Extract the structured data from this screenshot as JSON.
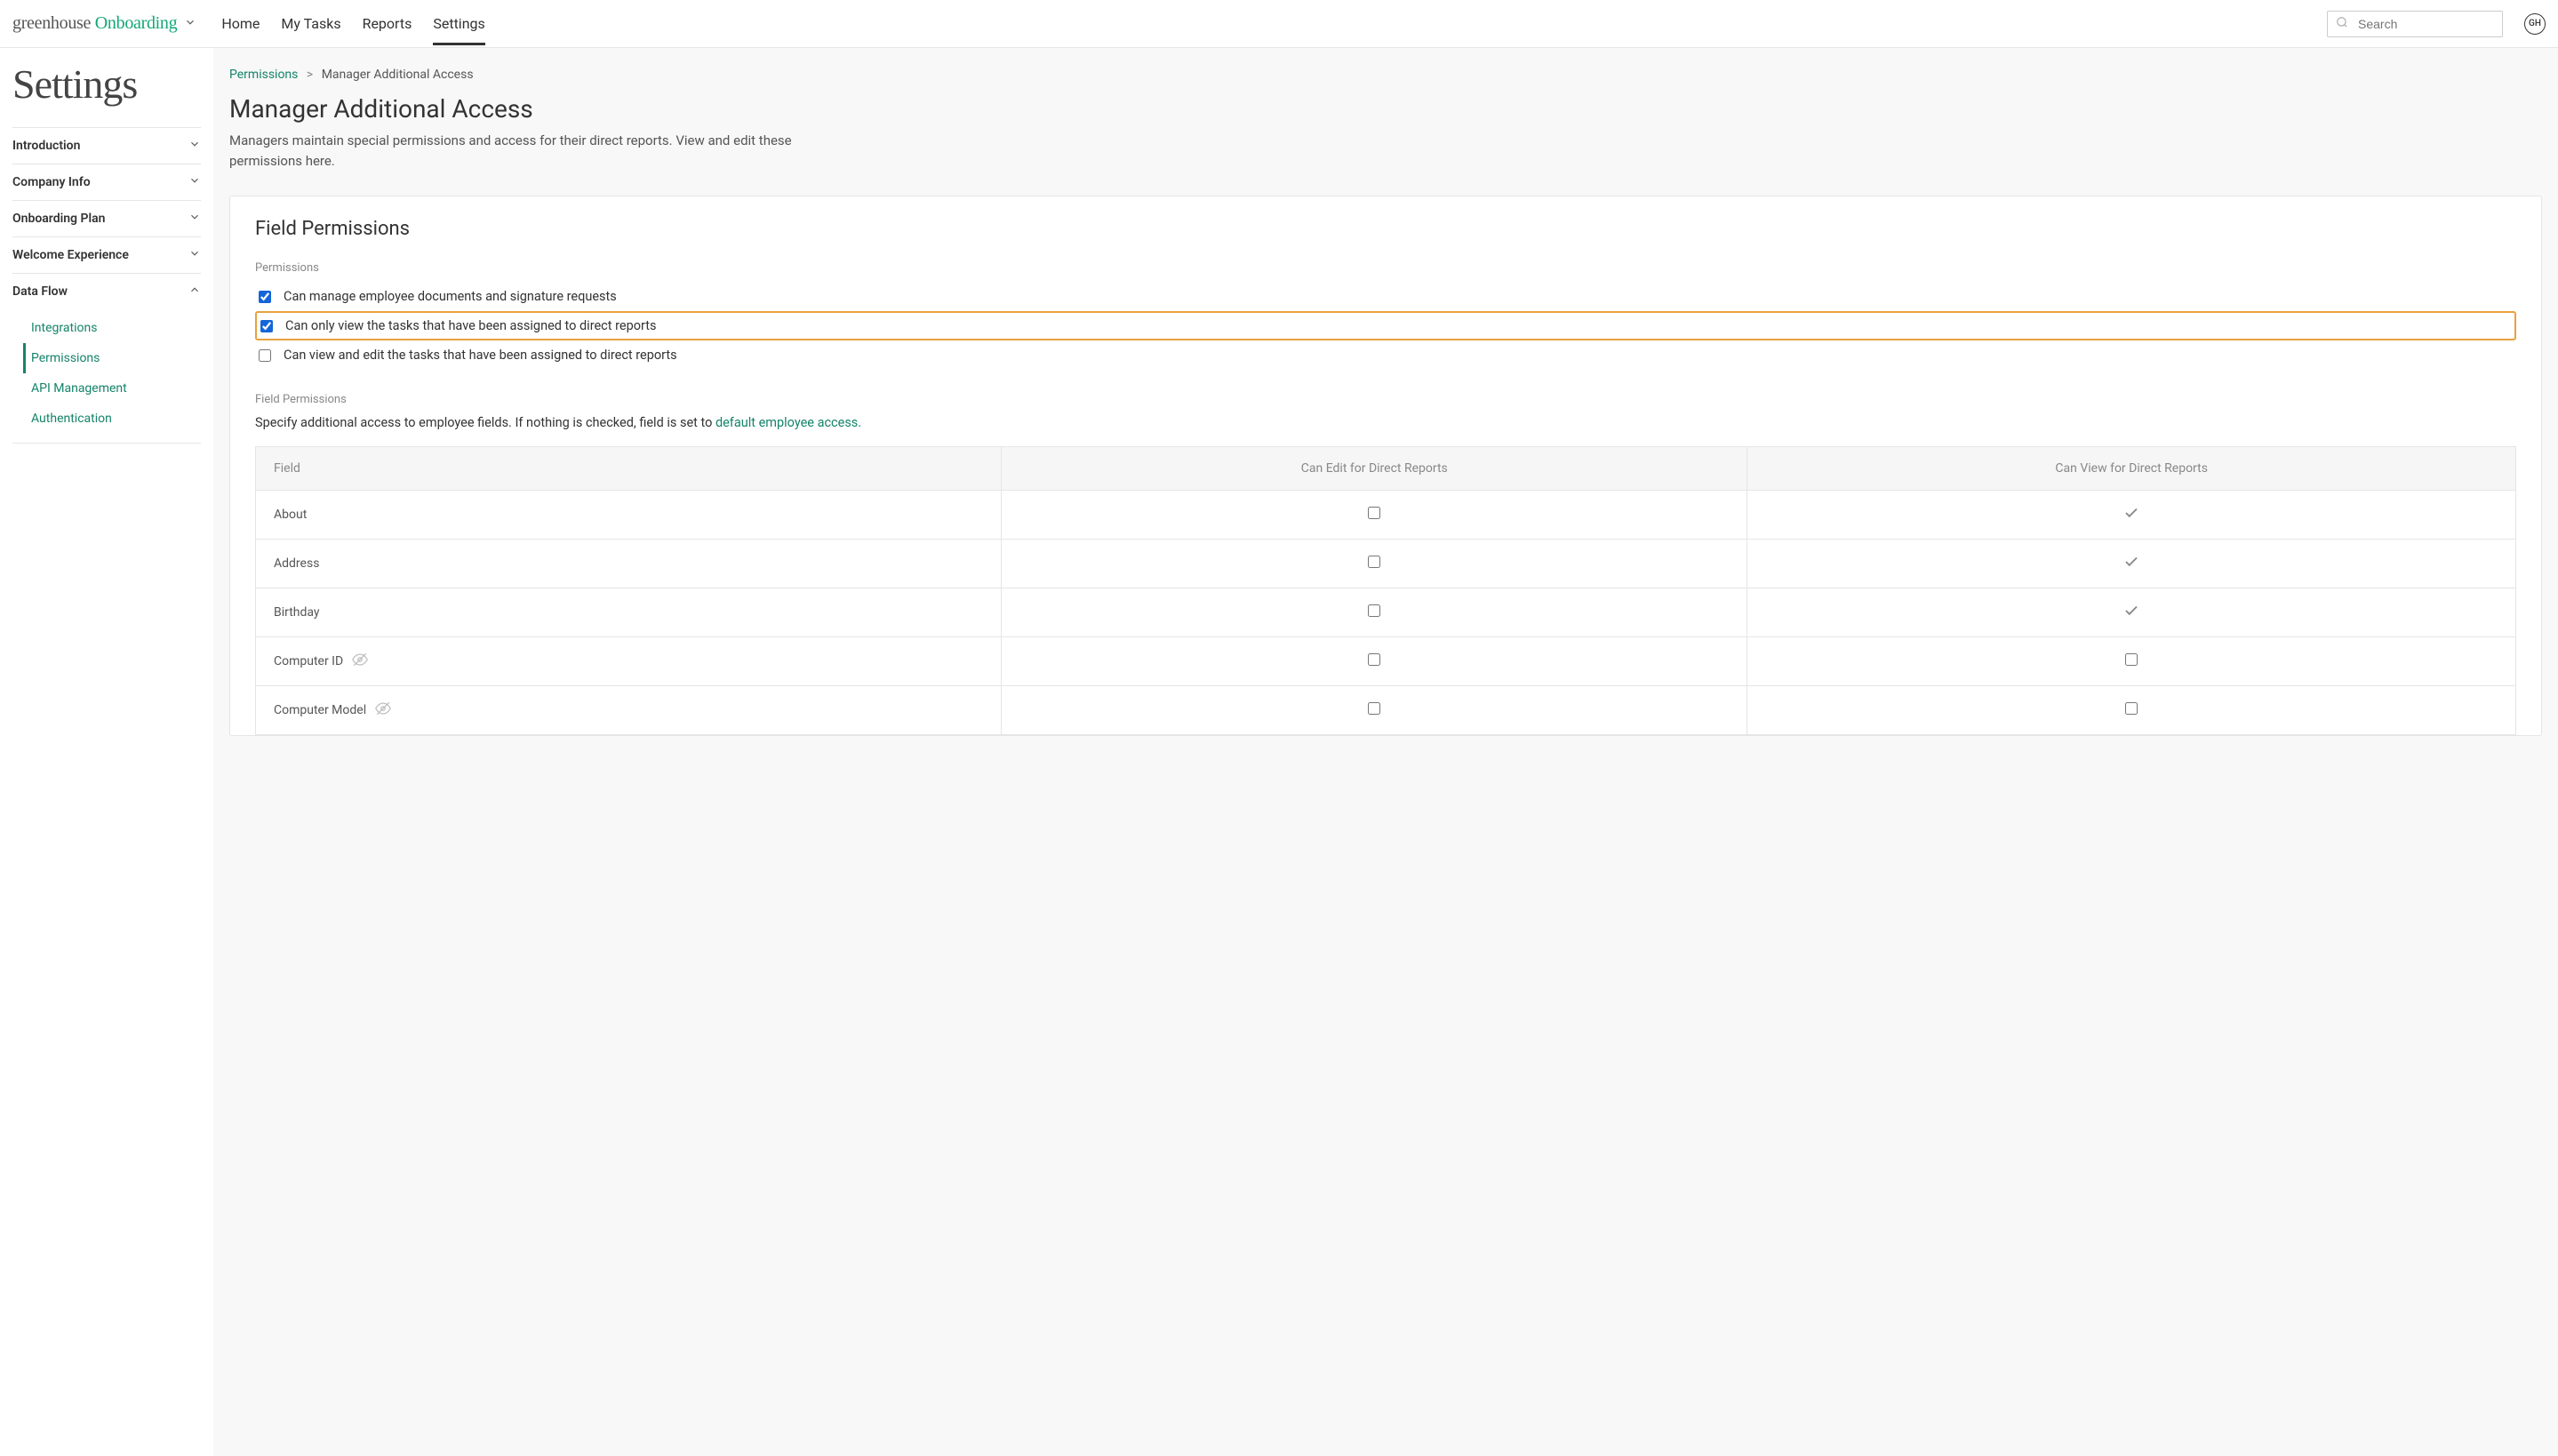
{
  "header": {
    "logo_primary": "greenhouse",
    "logo_secondary": "Onboarding",
    "nav": [
      {
        "label": "Home"
      },
      {
        "label": "My Tasks"
      },
      {
        "label": "Reports"
      },
      {
        "label": "Settings"
      }
    ],
    "search_placeholder": "Search",
    "avatar_initials": "GH"
  },
  "sidebar": {
    "title": "Settings",
    "sections": [
      {
        "label": "Introduction",
        "expanded": false
      },
      {
        "label": "Company Info",
        "expanded": false
      },
      {
        "label": "Onboarding Plan",
        "expanded": false
      },
      {
        "label": "Welcome Experience",
        "expanded": false
      },
      {
        "label": "Data Flow",
        "expanded": true,
        "items": [
          {
            "label": "Integrations"
          },
          {
            "label": "Permissions"
          },
          {
            "label": "API Management"
          },
          {
            "label": "Authentication"
          }
        ]
      }
    ]
  },
  "breadcrumb": {
    "parent": "Permissions",
    "sep": ">",
    "current": "Manager Additional Access"
  },
  "main": {
    "heading": "Manager Additional Access",
    "description": "Managers maintain special permissions and access for their direct reports. View and edit these permissions here."
  },
  "card": {
    "title": "Field Permissions",
    "perm_section_label": "Permissions",
    "perms": [
      {
        "label": "Can manage employee documents and signature requests",
        "checked": true,
        "highlight": false
      },
      {
        "label": "Can only view the tasks that have been assigned to direct reports",
        "checked": true,
        "highlight": true
      },
      {
        "label": "Can view and edit the tasks that have been assigned to direct reports",
        "checked": false,
        "highlight": false
      }
    ],
    "field_perm_label": "Field Permissions",
    "field_perm_text_pre": "Specify additional access to employee fields. If nothing is checked, field is set to ",
    "field_perm_link": "default employee access.",
    "table": {
      "headers": [
        "Field",
        "Can Edit for Direct Reports",
        "Can View for Direct Reports"
      ],
      "rows": [
        {
          "field": "About",
          "hidden": false,
          "edit_checked": false,
          "view_type": "check"
        },
        {
          "field": "Address",
          "hidden": false,
          "edit_checked": false,
          "view_type": "check"
        },
        {
          "field": "Birthday",
          "hidden": false,
          "edit_checked": false,
          "view_type": "check"
        },
        {
          "field": "Computer ID",
          "hidden": true,
          "edit_checked": false,
          "view_type": "checkbox",
          "view_checked": false
        },
        {
          "field": "Computer Model",
          "hidden": true,
          "edit_checked": false,
          "view_type": "checkbox",
          "view_checked": false
        }
      ]
    }
  }
}
